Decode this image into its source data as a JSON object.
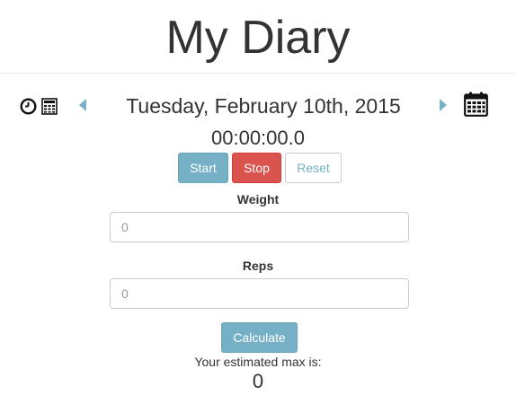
{
  "app": {
    "title": "My Diary"
  },
  "date_nav": {
    "date": "Tuesday, February 10th, 2015",
    "icons": [
      "clock-icon",
      "calculator-icon",
      "chevron-left-icon",
      "chevron-right-icon",
      "calendar-icon"
    ]
  },
  "timer": {
    "display": "00:00:00.0",
    "start_label": "Start",
    "stop_label": "Stop",
    "reset_label": "Reset"
  },
  "form": {
    "weight_label": "Weight",
    "weight_placeholder": "0",
    "reps_label": "Reps",
    "reps_placeholder": "0",
    "calculate_label": "Calculate"
  },
  "result": {
    "label": "Your estimated max is:",
    "value": "0"
  },
  "colors": {
    "primary": "#76b0c7",
    "danger": "#d9534f",
    "text": "#333333",
    "border": "#cccccc"
  }
}
